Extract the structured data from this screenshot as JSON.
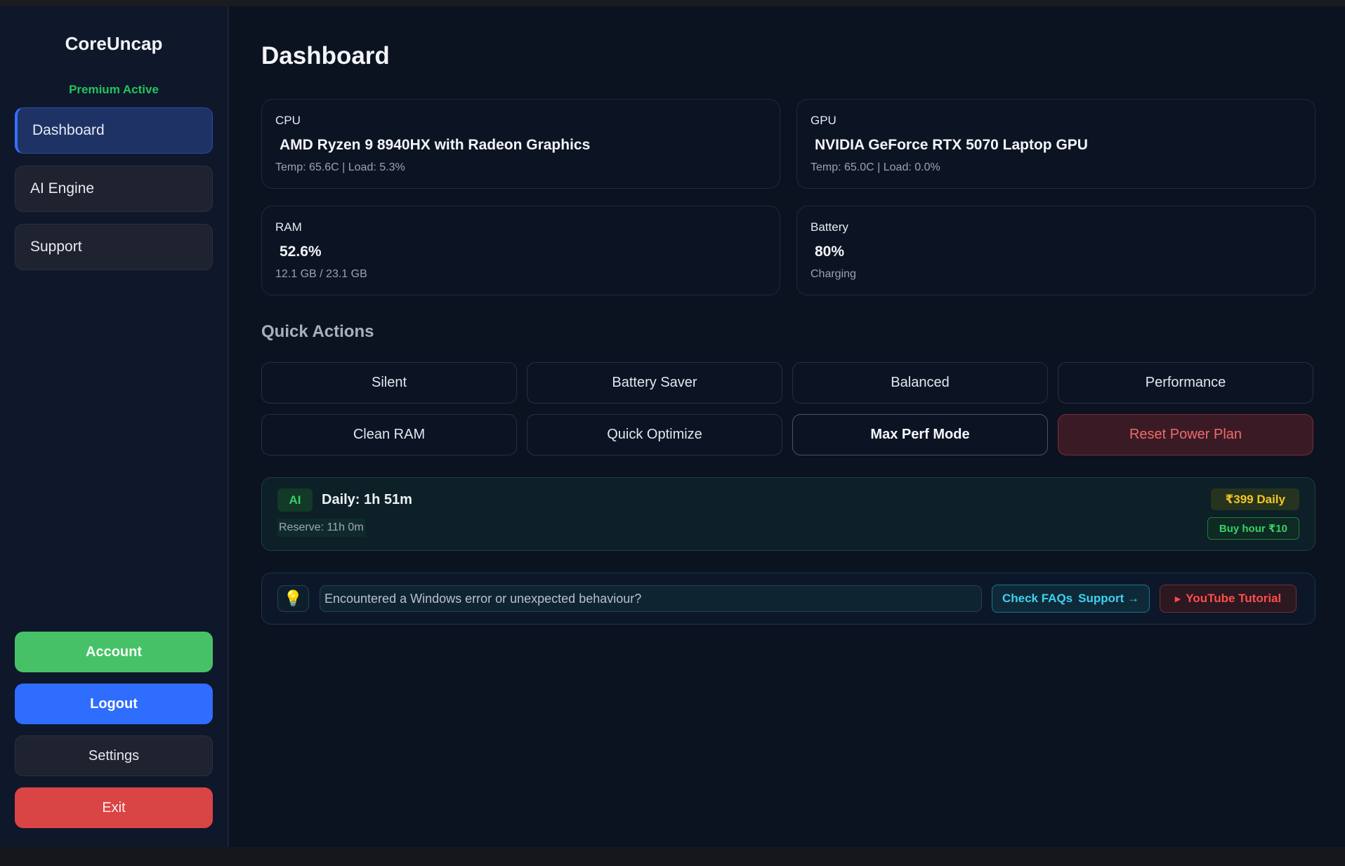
{
  "sidebar": {
    "brand": "CoreUncap",
    "status": "Premium Active",
    "nav": [
      {
        "label": "Dashboard",
        "active": true
      },
      {
        "label": "AI Engine",
        "active": false
      },
      {
        "label": "Support",
        "active": false
      }
    ],
    "account_label": "Account",
    "logout_label": "Logout",
    "settings_label": "Settings",
    "exit_label": "Exit"
  },
  "main": {
    "title": "Dashboard",
    "cards": {
      "cpu": {
        "label": "CPU",
        "value": "AMD Ryzen 9 8940HX with Radeon Graphics",
        "sub": "Temp: 65.6C | Load: 5.3%"
      },
      "gpu": {
        "label": "GPU",
        "value": "NVIDIA GeForce RTX 5070 Laptop GPU",
        "sub": "Temp: 65.0C | Load: 0.0%"
      },
      "ram": {
        "label": "RAM",
        "value": "52.6%",
        "sub": "12.1 GB / 23.1 GB"
      },
      "battery": {
        "label": "Battery",
        "value": "80%",
        "sub": "Charging"
      }
    },
    "quick_actions_title": "Quick Actions",
    "actions": [
      "Silent",
      "Battery Saver",
      "Balanced",
      "Performance",
      "Clean RAM",
      "Quick Optimize",
      "Max Perf Mode",
      "Reset Power Plan"
    ],
    "ai": {
      "badge": "AI",
      "daily": "Daily: 1h 51m",
      "reserve": "Reserve: 11h 0m",
      "price": "₹399 Daily",
      "buy": "Buy hour ₹10"
    },
    "help": {
      "message": "Encountered a Windows error or unexpected behaviour?",
      "faq_label": "Check FAQs",
      "support_label": "Support →",
      "youtube_label": "YouTube Tutorial"
    }
  },
  "icons": {
    "bulb": "lightbulb-icon",
    "play": "play-icon"
  },
  "colors": {
    "accent": "#3b6dff",
    "success": "#22c55e",
    "danger": "#d94444",
    "warning": "#f3c623"
  }
}
